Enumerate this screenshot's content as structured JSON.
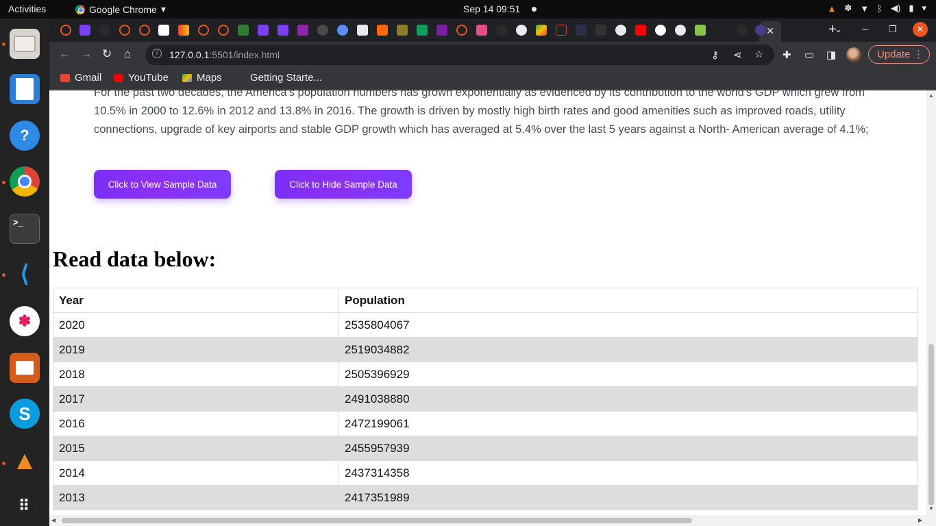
{
  "system": {
    "activities": "Activities",
    "app_name": "Google Chrome",
    "clock": "Sep 14  09:51"
  },
  "browser": {
    "active_tab_close": "✕",
    "url_host": "127.0.0.1",
    "url_path": ":5501/index.html",
    "update_label": "Update",
    "bookmarks": [
      {
        "label": "Gmail",
        "icon": "gmail-icon",
        "color": "#ea4335"
      },
      {
        "label": "YouTube",
        "icon": "youtube-icon",
        "color": "#ff0000"
      },
      {
        "label": "Maps",
        "icon": "maps-icon",
        "color": "#34a853"
      },
      {
        "label": "Getting Starte...",
        "icon": "page-icon",
        "color": "#35363a"
      }
    ]
  },
  "page": {
    "intro_text": "For the past two decades, the America's population numbers has grown exponentially as evidenced by its contribution to the world's GDP which grew from 10.5% in 2000 to 12.6% in 2012 and 13.8% in 2016. The growth is driven by mostly high birth rates and good amenities such as improved roads, utility connections, upgrade of key airports and stable GDP growth which has averaged at 5.4% over the last 5 years against a North- American average of 4.1%;",
    "view_button": "Click to View Sample Data",
    "hide_button": "Click to Hide Sample Data",
    "heading": "Read data below:",
    "table": {
      "headers": [
        "Year",
        "Population"
      ],
      "rows": [
        [
          "2020",
          "2535804067"
        ],
        [
          "2019",
          "2519034882"
        ],
        [
          "2018",
          "2505396929"
        ],
        [
          "2017",
          "2491038880"
        ],
        [
          "2016",
          "2472199061"
        ],
        [
          "2015",
          "2455957939"
        ],
        [
          "2014",
          "2437314358"
        ],
        [
          "2013",
          "2417351989"
        ]
      ]
    }
  },
  "colors": {
    "button_gradient_start": "#7a2ff7",
    "button_gradient_end": "#7d3cff",
    "row_stripe": "#dddddd"
  }
}
